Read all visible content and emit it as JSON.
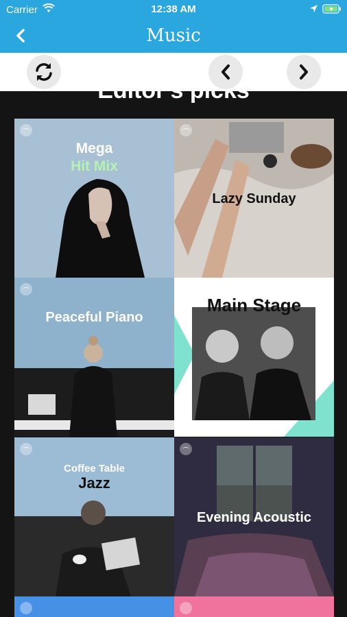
{
  "status_bar": {
    "carrier": "Carrier",
    "time": "12:38 AM"
  },
  "nav": {
    "title": "Music",
    "back_icon": "chevron-left-icon"
  },
  "toolbar": {
    "refresh_icon": "refresh-icon",
    "prev_icon": "chevron-left-icon",
    "next_icon": "chevron-right-icon"
  },
  "content": {
    "section_title": "Editor's picks"
  },
  "playlists": [
    {
      "line1": "Mega",
      "line2": "Hit Mix"
    },
    {
      "line1": "Lazy Sunday"
    },
    {
      "line1": "Peaceful Piano"
    },
    {
      "line1": "Main Stage"
    },
    {
      "line1": "Coffee Table",
      "line2": "Jazz"
    },
    {
      "line1": "Evening Acoustic"
    }
  ],
  "colors": {
    "nav_bg": "#29a7de",
    "toolbar_bg": "#ffffff",
    "content_bg": "#141414"
  }
}
